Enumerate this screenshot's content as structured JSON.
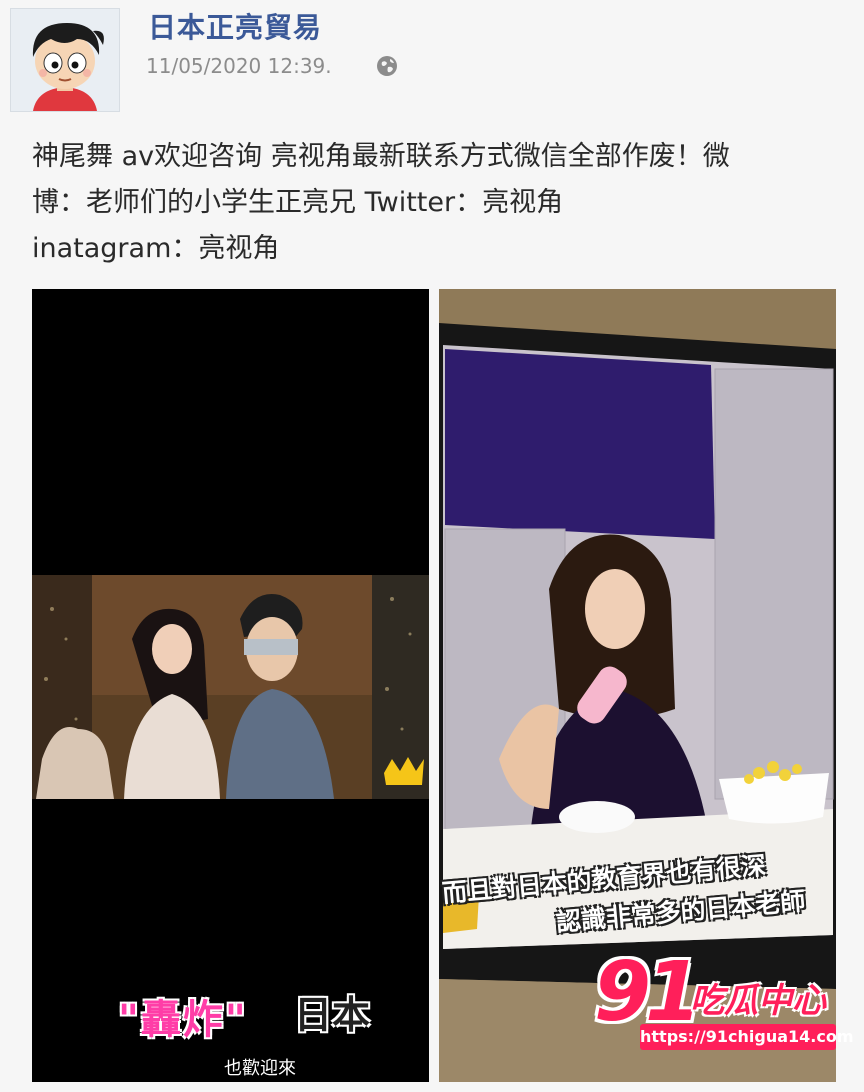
{
  "post": {
    "page_name": "日本正亮貿易",
    "timestamp": "11/05/2020 12:39.",
    "privacy_icon": "globe-icon",
    "text_lines": [
      "神尾舞 av欢迎咨询 亮视角最新联系方式微信全部作废！微",
      "博：老师们的小学生正亮兄 Twitter：亮视角",
      "inatagram：亮视角"
    ]
  },
  "photos": {
    "left": {
      "caption_pink": "\"轟炸\"",
      "caption_dark": "日本",
      "subtitle": "也歡迎來"
    },
    "right": {
      "subtitle_line1": "而且對日本的教育界也有很深",
      "subtitle_line2": "認識非常多的日本老師"
    }
  },
  "watermark": {
    "logo_number": "91",
    "logo_text": "吃瓜中心",
    "url": "https://91chigua14.com"
  },
  "colors": {
    "name_blue": "#3b5998",
    "watermark_pink": "#ff1f5a",
    "caption_pink": "#ff3da7"
  }
}
